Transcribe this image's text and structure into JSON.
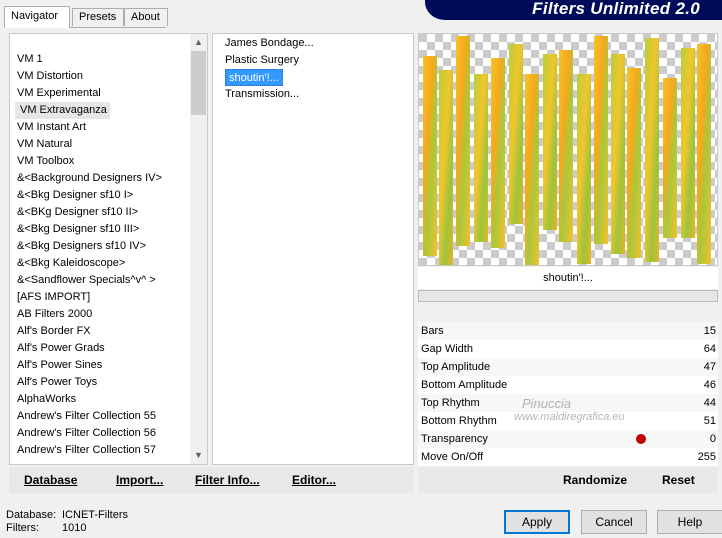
{
  "tabs": [
    {
      "label": "Navigator",
      "active": true
    },
    {
      "label": "Presets",
      "active": false
    },
    {
      "label": "About",
      "active": false
    }
  ],
  "banner": {
    "title": "Filters Unlimited 2.0"
  },
  "categories": {
    "selected_index": 3,
    "items": [
      "VM 1",
      "VM Distortion",
      "VM Experimental",
      "VM Extravaganza",
      "VM Instant Art",
      "VM Natural",
      "VM Toolbox",
      "&<Background Designers IV>",
      "&<Bkg Designer sf10 I>",
      "&<BKg Designer sf10 II>",
      "&<Bkg Designer sf10 III>",
      "&<Bkg Designers sf10 IV>",
      "&<Bkg Kaleidoscope>",
      "&<Sandflower Specials^v^ >",
      "[AFS IMPORT]",
      "AB Filters 2000",
      "Alf's Border FX",
      "Alf's Power Grads",
      "Alf's Power Sines",
      "Alf's Power Toys",
      "AlphaWorks",
      "Andrew's Filter Collection 55",
      "Andrew's Filter Collection 56",
      "Andrew's Filter Collection 57"
    ]
  },
  "filters": {
    "selected_index": 2,
    "items": [
      "James Bondage...",
      "Plastic Surgery",
      "shoutin'!...",
      "Transmission..."
    ]
  },
  "preview": {
    "filter_name": "shoutin'!..."
  },
  "params": [
    {
      "label": "Bars",
      "value": "15"
    },
    {
      "label": "Gap Width",
      "value": "64"
    },
    {
      "label": "Top Amplitude",
      "value": "47"
    },
    {
      "label": "Bottom Amplitude",
      "value": "46"
    },
    {
      "label": "Top Rhythm",
      "value": "44"
    },
    {
      "label": "Bottom Rhythm",
      "value": "51"
    },
    {
      "label": "Transparency",
      "value": "0"
    },
    {
      "label": "Move On/Off",
      "value": "255"
    }
  ],
  "left_buttons": {
    "database": "Database",
    "import": "Import...",
    "filter_info": "Filter Info...",
    "editor": "Editor..."
  },
  "right_buttons": {
    "randomize": "Randomize",
    "reset": "Reset"
  },
  "footer": {
    "database_label": "Database:",
    "database_value": "ICNET-Filters",
    "filters_label": "Filters:",
    "filters_value": "1010"
  },
  "dialog_buttons": {
    "apply": "Apply",
    "cancel": "Cancel",
    "help": "Help"
  },
  "watermark": {
    "line1": "Pinuccia",
    "line2": "www.maldiregrafica.eu"
  },
  "colors": {
    "banner_bg": "#000c5a",
    "selection": "#3399ff",
    "slider_knob": "#c00000"
  }
}
